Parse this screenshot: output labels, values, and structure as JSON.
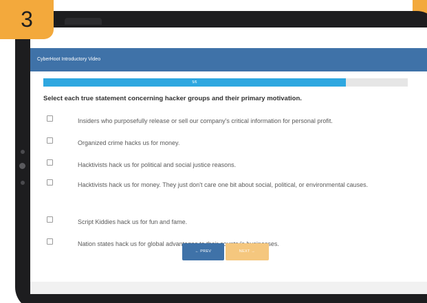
{
  "badge": {
    "step_number": "3"
  },
  "course": {
    "title": "CyberHoot Introductory Video"
  },
  "progress": {
    "label": "5/6",
    "fraction": 0.83
  },
  "question": {
    "text": "Select each true statement concerning hacker groups and their primary motivation."
  },
  "options": [
    {
      "label": "Insiders who purposefully release or sell our company's critical information for personal profit.",
      "checked": false
    },
    {
      "label": "Organized crime hacks us for money.",
      "checked": false
    },
    {
      "label": "Hacktivists hack us for political and social justice reasons.",
      "checked": false
    },
    {
      "label": "Hacktivists hack us for money. They just don't care one bit about social, political, or environmental causes.",
      "checked": false
    },
    {
      "label": "Script Kiddies hack us for fun and fame.",
      "checked": false
    },
    {
      "label": "Nation states hack us for global advantages to their country's businesses.",
      "checked": false
    }
  ],
  "nav": {
    "prev_label": "← PREV",
    "next_label": "NEXT →"
  },
  "colors": {
    "accent_orange": "#f3a93c",
    "header_blue": "#3f72a8",
    "progress_blue": "#2ea7e0",
    "next_disabled": "#f5c77e",
    "bezel": "#1d1d1f"
  }
}
